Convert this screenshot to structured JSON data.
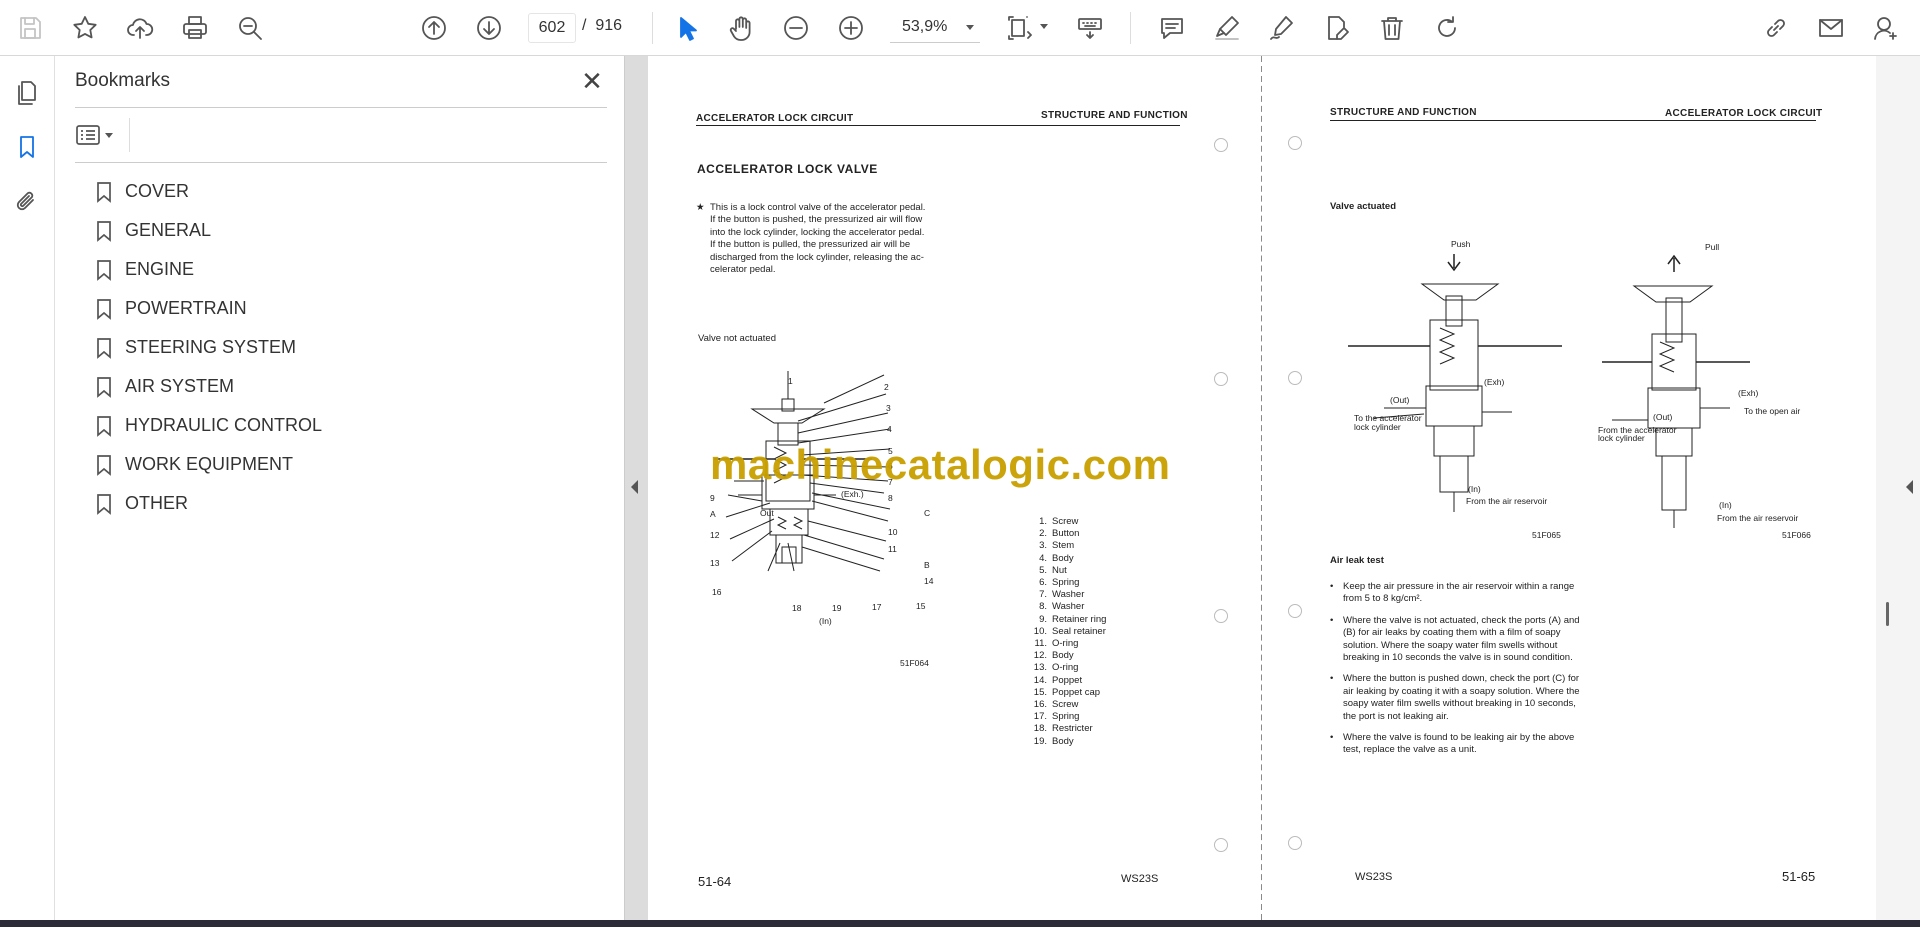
{
  "toolbar": {
    "page_current": "602",
    "page_separator": "/",
    "page_total": "916",
    "zoom": "53,9%"
  },
  "sidebar": {
    "title": "Bookmarks",
    "close_glyph": "✕",
    "items": [
      {
        "label": "COVER"
      },
      {
        "label": "GENERAL"
      },
      {
        "label": "ENGINE"
      },
      {
        "label": "POWERTRAIN"
      },
      {
        "label": "STEERING SYSTEM"
      },
      {
        "label": "AIR SYSTEM"
      },
      {
        "label": "HYDRAULIC CONTROL"
      },
      {
        "label": "WORK EQUIPMENT"
      },
      {
        "label": "OTHER"
      }
    ]
  },
  "watermark": "machinecatalogic.com",
  "page_left": {
    "header_left": "ACCELERATOR LOCK CIRCUIT",
    "header_right": "STRUCTURE AND FUNCTION",
    "title": "ACCELERATOR LOCK VALVE",
    "note_mark": "★",
    "description_lines": [
      "This is a lock control valve of the accelerator pedal.",
      "If the button is pushed, the pressurized air will flow",
      "into the lock cylinder, locking the accelerator pedal.",
      "If the button is pulled, the pressurized air will be",
      "discharged from the lock cylinder, releasing the ac-",
      "celerator pedal."
    ],
    "subtitle": "Valve not actuated",
    "figure_id": "51F064",
    "figure_labels": {
      "out": "Out",
      "exh": "(Exh.)",
      "in": "(In)",
      "a": "A",
      "b": "B",
      "c": "C"
    },
    "callout_numbers": [
      "1",
      "2",
      "3",
      "4",
      "5",
      "6",
      "7",
      "8",
      "9",
      "10",
      "11",
      "12",
      "13",
      "14",
      "15",
      "16",
      "17",
      "18",
      "19"
    ],
    "parts": [
      {
        "n": "1.",
        "name": "Screw"
      },
      {
        "n": "2.",
        "name": "Button"
      },
      {
        "n": "3.",
        "name": "Stem"
      },
      {
        "n": "4.",
        "name": "Body"
      },
      {
        "n": "5.",
        "name": "Nut"
      },
      {
        "n": "6.",
        "name": "Spring"
      },
      {
        "n": "7.",
        "name": "Washer"
      },
      {
        "n": "8.",
        "name": "Washer"
      },
      {
        "n": "9.",
        "name": "Retainer ring"
      },
      {
        "n": "10.",
        "name": "Seal retainer"
      },
      {
        "n": "11.",
        "name": "O-ring"
      },
      {
        "n": "12.",
        "name": "Body"
      },
      {
        "n": "13.",
        "name": "O-ring"
      },
      {
        "n": "14.",
        "name": "Poppet"
      },
      {
        "n": "15.",
        "name": "Poppet cap"
      },
      {
        "n": "16.",
        "name": "Screw"
      },
      {
        "n": "17.",
        "name": "Spring"
      },
      {
        "n": "18.",
        "name": "Restricter"
      },
      {
        "n": "19.",
        "name": "Body"
      }
    ],
    "footer_page": "51-64",
    "footer_model": "WS23S"
  },
  "page_right": {
    "header_left": "STRUCTURE AND FUNCTION",
    "header_right": "ACCELERATOR LOCK CIRCUIT",
    "subtitle": "Valve actuated",
    "fig1": {
      "label_top": "Push",
      "out": "(Out)",
      "exh": "(Exh)",
      "to_line1": "To the accelerator",
      "to_line2": "lock cylinder",
      "in": "(In)",
      "from": "From the air reservoir",
      "id": "51F065"
    },
    "fig2": {
      "label_top": "Pull",
      "exh": "(Exh)",
      "to_open": "To the open air",
      "out": "(Out)",
      "from_line1": "From the accelerator",
      "from_line2": "lock cylinder",
      "in": "(In)",
      "from": "From the air reservoir",
      "id": "51F066"
    },
    "leak_title": "Air leak test",
    "leak_items": [
      "Keep the air pressure in the air reservoir within a range from 5 to 8 kg/cm².",
      "Where the valve is not actuated, check the ports (A) and (B) for air leaks by coating them with a film of soapy solution. Where the soapy water film swells without breaking in 10 seconds the valve is in sound condition.",
      "Where the button is pushed down, check the port (C) for air leaking by coating it with a soapy solution. Where the soapy water film swells without breaking in 10 seconds, the port is not leaking air.",
      "Where the valve is found to be leaking air by the above test, replace the valve as a unit."
    ],
    "footer_model": "WS23S",
    "footer_page": "51-65"
  }
}
